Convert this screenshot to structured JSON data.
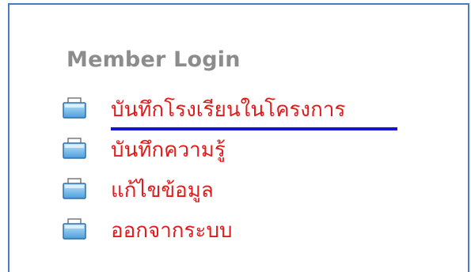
{
  "login_box": {
    "title": "Member Login",
    "items": [
      {
        "label": "บันทึกโรงเรียนในโครงการ",
        "icon": "folder-icon",
        "active": true
      },
      {
        "label": "บันทึกความรู้",
        "icon": "folder-icon",
        "active": false
      },
      {
        "label": "แก้ไขข้อมูล",
        "icon": "folder-icon",
        "active": false
      },
      {
        "label": "ออกจากระบบ",
        "icon": "folder-icon",
        "active": false
      }
    ]
  },
  "colors": {
    "border": "#4a7cc0",
    "title": "#8c8c8c",
    "link": "#e01b1b",
    "active_underline": "#1414d8"
  }
}
